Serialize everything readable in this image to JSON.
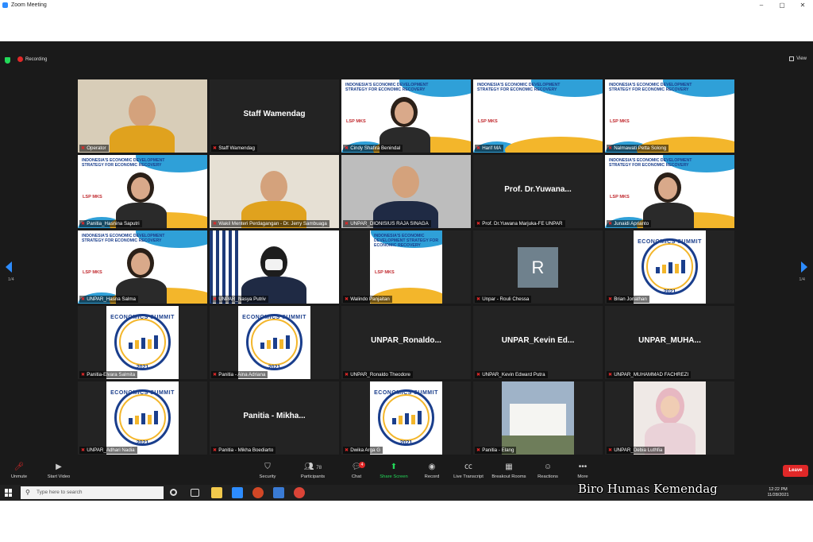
{
  "window": {
    "title": "Zoom Meeting",
    "min": "–",
    "max": "▢",
    "close": "✕"
  },
  "topbar": {
    "recording": "Recording",
    "view": "View"
  },
  "nav": {
    "page_left": "1/4",
    "page_right": "1/4"
  },
  "tiles": [
    {
      "name": "Operator",
      "type": "video",
      "bigname": ""
    },
    {
      "name": "Staff Wamendag",
      "type": "name",
      "bigname": "Staff Wamendag"
    },
    {
      "name": "Cindy Shafira Benindal",
      "type": "banner-person",
      "bigname": ""
    },
    {
      "name": "Harif MA",
      "type": "banner",
      "bigname": ""
    },
    {
      "name": "Nalmawati Petta Solong",
      "type": "banner",
      "bigname": ""
    },
    {
      "name": "Panitia_Hasnina Saputri",
      "type": "banner-person",
      "bigname": ""
    },
    {
      "name": "Wakil Menteri Perdagangan - Dr. Jerry Sambuaga",
      "type": "video",
      "bigname": ""
    },
    {
      "name": "UNPAR_DIONISIUS RAJA SINAGA",
      "type": "video",
      "bigname": ""
    },
    {
      "name": "Prof. Dr.Yuwana Marjuka-FE UNPAR",
      "type": "name",
      "bigname": "Prof. Dr.Yuwana..."
    },
    {
      "name": "Junaidi Aprianto",
      "type": "banner-person",
      "bigname": ""
    },
    {
      "name": "UNPAR_Hasna Salma",
      "type": "banner-person",
      "bigname": ""
    },
    {
      "name": "UNPAR_Nasya Putriv",
      "type": "video",
      "bigname": ""
    },
    {
      "name": "Walindo Panjaitan",
      "type": "banner-small",
      "bigname": ""
    },
    {
      "name": "Unpar - Rouli Chessa",
      "type": "avatar",
      "bigname": "",
      "avatar": "R"
    },
    {
      "name": "Brian Jonathan",
      "type": "logo",
      "bigname": ""
    },
    {
      "name": "Panitia-Elvara Salmita",
      "type": "logo",
      "bigname": ""
    },
    {
      "name": "Panitia - Aina Adriana",
      "type": "logo",
      "bigname": ""
    },
    {
      "name": "UNPAR_Ronaldo Theodore",
      "type": "name",
      "bigname": "UNPAR_Ronaldo..."
    },
    {
      "name": "UNPAR_Kevin Edward Putra",
      "type": "name",
      "bigname": "UNPAR_Kevin Ed..."
    },
    {
      "name": "UNPAR_MUHAMMAD FACHREZI",
      "type": "name",
      "bigname": "UNPAR_MUHA..."
    },
    {
      "name": "UNPAR_Adhari Nadia",
      "type": "logo",
      "bigname": ""
    },
    {
      "name": "Panitia - Mikha Boediarto",
      "type": "name",
      "bigname": "Panitia - Mikha..."
    },
    {
      "name": "Dwika Arga G",
      "type": "logo",
      "bigname": ""
    },
    {
      "name": "Panitia - Elang",
      "type": "photo",
      "bigname": ""
    },
    {
      "name": "UNPAR_Debia Luthfia",
      "type": "portrait",
      "bigname": ""
    }
  ],
  "banner": {
    "headline": "INDONESIA'S ECONOMIC DEVELOPMENT STRATEGY FOR ECONOMIC RECOVERY",
    "sponsor": "LSP MKS"
  },
  "logo": {
    "top": "ECONOMICS SUMMIT",
    "year": "2021"
  },
  "toolbar": {
    "unmute": "Unmute",
    "start_video": "Start Video",
    "security": "Security",
    "participants": "Participants",
    "participants_count": "78",
    "chat": "Chat",
    "chat_badge": "4",
    "share": "Share Screen",
    "record": "Record",
    "transcript": "Live Transcript",
    "breakout": "Breakout Rooms",
    "reactions": "Reactions",
    "more": "More",
    "leave": "Leave"
  },
  "taskbar": {
    "search_placeholder": "Type here to search",
    "time": "12:22 PM",
    "date": "11/28/2021"
  },
  "watermark": "Biro Humas Kemendag",
  "colors": {
    "zoom_blue": "#2d8cff",
    "leave_red": "#e02828",
    "active_speaker": "#d6e63a",
    "share_green": "#23d959"
  }
}
